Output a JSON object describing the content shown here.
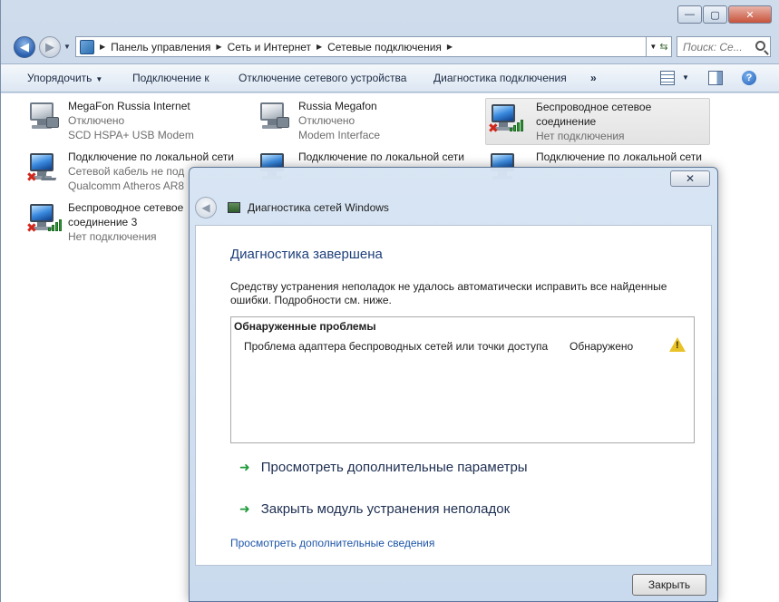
{
  "window": {
    "minimize_label": "—",
    "maximize_label": "▢",
    "close_label": "✕"
  },
  "address": {
    "crumbs": [
      "Панель управления",
      "Сеть и Интернет",
      "Сетевые подключения"
    ],
    "search_placeholder": "Поиск: Се..."
  },
  "toolbar": {
    "organize": "Упорядочить",
    "connect_to": "Подключение к",
    "disable_device": "Отключение сетевого устройства",
    "diagnose": "Диагностика подключения",
    "more": "»",
    "help": "?"
  },
  "connections": [
    {
      "name": "MegaFon Russia Internet",
      "status": "Отключено",
      "device": "SCD HSPA+ USB Modem"
    },
    {
      "name": "Russia Megafon",
      "status": "Отключено",
      "device": "Modem Interface"
    },
    {
      "name": "Беспроводное сетевое",
      "name2": "соединение",
      "status": "Нет подключения"
    },
    {
      "name": "Подключение по локальной сети",
      "status": "Сетевой кабель не под",
      "device": "Qualcomm Atheros AR8"
    },
    {
      "name": "Подключение по локальной сети"
    },
    {
      "name": "Подключение по локальной сети"
    },
    {
      "name": "Беспроводное сетевое",
      "name2": "соединение 3",
      "status": "Нет подключения"
    }
  ],
  "dialog": {
    "close_label": "✕",
    "title": "Диагностика сетей Windows",
    "heading": "Диагностика завершена",
    "description": "Средству устранения неполадок не удалось автоматически исправить все найденные ошибки. Подробности см. ниже.",
    "problems_header": "Обнаруженные проблемы",
    "problem_name": "Проблема адаптера беспроводных сетей или точки доступа",
    "problem_status": "Обнаружено",
    "action_view_more": "Просмотреть дополнительные параметры",
    "action_close_tool": "Закрыть модуль устранения неполадок",
    "more_info_link": "Просмотреть дополнительные сведения",
    "close_button": "Закрыть"
  }
}
